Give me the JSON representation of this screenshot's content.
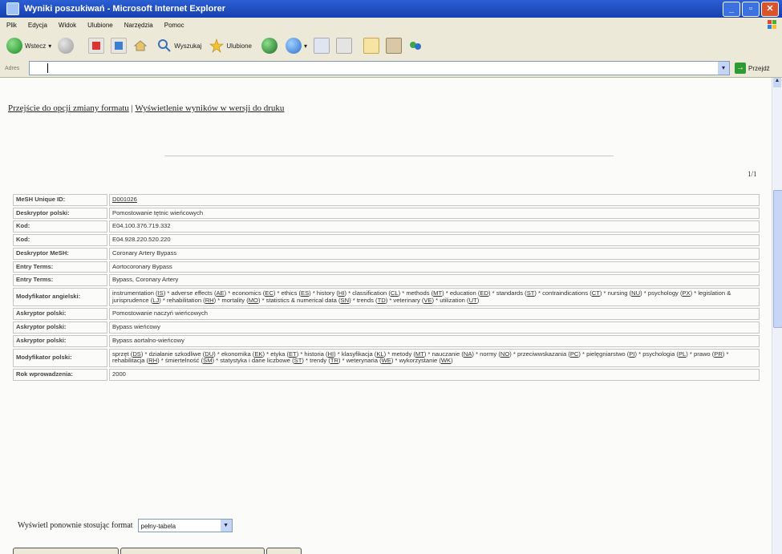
{
  "window": {
    "title": "Wyniki poszukiwań - Microsoft Internet Explorer"
  },
  "menu": [
    "Plik",
    "Edycja",
    "Widok",
    "Ulubione",
    "Narzędzia",
    "Pomoc"
  ],
  "toolbar": {
    "back": "Wstecz",
    "search": "Wyszukaj",
    "favorites": "Ulubione"
  },
  "address": {
    "label": "Adres",
    "go": "Przejdź"
  },
  "links": {
    "format": "Przejście do opcji zmiany formatu",
    "separator": "|",
    "print": "Wyświetlenie wyników w wersji do druku"
  },
  "pagecount": "1/1",
  "record": {
    "mesh_id_label": "MeSH Unique ID:",
    "mesh_id": "D001026",
    "polish_descriptor_label": "Deskryptor polski:",
    "polish_descriptor": "Pomostowanie tętnic wieńcowych",
    "code_label": "Kod:",
    "code1": "E04.100.376.719.332",
    "code2": "E04.928.220.520.220",
    "mesh_descriptor_label": "Deskryptor MeSH:",
    "mesh_descriptor": "Coronary Artery Bypass",
    "entry_terms_label": "Entry Terms:",
    "entry_term1": "Aortocoronary Bypass",
    "entry_term2": "Bypass, Coronary Artery",
    "english_modifier_label": "Modyfikator angielski:",
    "english_modifiers": [
      {
        "t": "instrumentation",
        "c": "IS"
      },
      {
        "t": "adverse effects",
        "c": "AE"
      },
      {
        "t": "economics",
        "c": "EC"
      },
      {
        "t": "ethics",
        "c": "ES"
      },
      {
        "t": "history",
        "c": "HI"
      },
      {
        "t": "classification",
        "c": "CL"
      },
      {
        "t": "methods",
        "c": "MT"
      },
      {
        "t": "education",
        "c": "ED"
      },
      {
        "t": "standards",
        "c": "ST"
      },
      {
        "t": "contraindications",
        "c": "CT"
      },
      {
        "t": "nursing",
        "c": "NU"
      },
      {
        "t": "psychology",
        "c": "PX"
      },
      {
        "t": "legislation & jurisprudence",
        "c": "LJ"
      },
      {
        "t": "rehabilitation",
        "c": "RH"
      },
      {
        "t": "mortality",
        "c": "MO"
      },
      {
        "t": "statistics & numerical data",
        "c": "SN"
      },
      {
        "t": "trends",
        "c": "TD"
      },
      {
        "t": "veterinary",
        "c": "VE"
      },
      {
        "t": "utilization",
        "c": "UT"
      }
    ],
    "polish_ascriptor_label": "Askryptor polski:",
    "polish_ascriptor1": "Pomostowanie naczyń wieńcowych",
    "polish_ascriptor2": "Bypass wieńcowy",
    "polish_ascriptor3": "Bypass aortalno-wieńcowy",
    "polish_modifier_label": "Modyfikator polski:",
    "polish_modifiers": [
      {
        "t": "sprzęt",
        "c": "DS"
      },
      {
        "t": "działanie szkodliwe",
        "c": "DU"
      },
      {
        "t": "ekonomika",
        "c": "EK"
      },
      {
        "t": "etyka",
        "c": "ET"
      },
      {
        "t": "historia",
        "c": "HI"
      },
      {
        "t": "klasyfikacja",
        "c": "KL"
      },
      {
        "t": "metody",
        "c": "MT"
      },
      {
        "t": "nauczanie",
        "c": "NA"
      },
      {
        "t": "normy",
        "c": "NO"
      },
      {
        "t": "przeciwwskazania",
        "c": "PC"
      },
      {
        "t": "pielęgniarstwo",
        "c": "PI"
      },
      {
        "t": "psychologia",
        "c": "PL"
      },
      {
        "t": "prawo",
        "c": "PR"
      },
      {
        "t": "rehabilitacja",
        "c": "RH"
      },
      {
        "t": "śmiertelność",
        "c": "SM"
      },
      {
        "t": "statystyka i dane liczbowe",
        "c": "ST"
      },
      {
        "t": "trendy",
        "c": "TR"
      },
      {
        "t": "weterynaria",
        "c": "WE"
      },
      {
        "t": "wykorzystanie",
        "c": "WK"
      }
    ],
    "year_label": "Rok wprowadzenia:",
    "year": "2000"
  },
  "format": {
    "label": "Wyświetl ponownie stosując format",
    "value": "pełny-tabela"
  }
}
